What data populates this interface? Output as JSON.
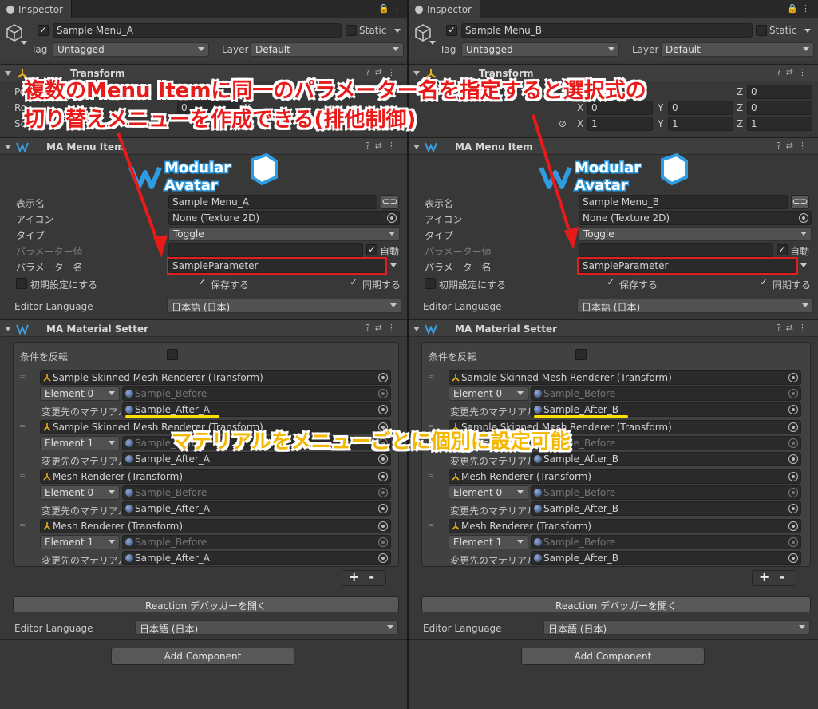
{
  "inspectors": [
    {
      "tab_label": "Inspector",
      "object_name": "Sample Menu_A",
      "static_label": "Static",
      "tag_label": "Tag",
      "tag_value": "Untagged",
      "layer_label": "Layer",
      "layer_value": "Default",
      "transform": {
        "title": "Transform",
        "pos_label": "Po",
        "rot_label": "Ro",
        "scale_label": "Sca",
        "row2_x": "0",
        "row2_mid": "X",
        "row3_mid": "1"
      },
      "menu_item": {
        "title": "MA Menu Item",
        "logo_line1": "Modular",
        "logo_line2": "Avatar",
        "display_name_label": "表示名",
        "display_name_value": "Sample Menu_A",
        "icon_label": "アイコン",
        "icon_value": "None (Texture 2D)",
        "type_label": "タイプ",
        "type_value": "Toggle",
        "param_value_label": "パラメーター値",
        "auto_label": "自動",
        "param_name_label": "パラメーター名",
        "param_name_value": "SampleParameter",
        "default_label": "初期設定にする",
        "saved_label": "保存する",
        "synced_label": "同期する",
        "editor_lang_label": "Editor Language",
        "editor_lang_value": "日本語 (日本)"
      },
      "material_setter": {
        "title": "MA Material Setter",
        "invert_label": "条件を反転",
        "change_label": "変更先のマテリアル",
        "entries": [
          {
            "renderer": "Sample Skinned Mesh Renderer (Transform)",
            "element": "Element 0",
            "before": "Sample_Before",
            "after": "Sample_After_A"
          },
          {
            "renderer": "Sample Skinned Mesh Renderer (Transform)",
            "element": "Element 1",
            "before": "Sample_Before",
            "after": "Sample_After_A"
          },
          {
            "renderer": "Mesh Renderer (Transform)",
            "element": "Element 0",
            "before": "Sample_Before",
            "after": "Sample_After_A"
          },
          {
            "renderer": "Mesh Renderer (Transform)",
            "element": "Element 1",
            "before": "Sample_Before",
            "after": "Sample_After_A"
          }
        ],
        "plus": "+",
        "minus": "-",
        "debugger_button": "Reaction デバッガーを開く",
        "editor_lang_label": "Editor Language",
        "editor_lang_value": "日本語 (日本)"
      },
      "add_component": "Add Component"
    },
    {
      "tab_label": "Inspector",
      "object_name": "Sample Menu_B",
      "static_label": "Static",
      "tag_label": "Tag",
      "tag_value": "Untagged",
      "layer_label": "Layer",
      "layer_value": "Default",
      "transform": {
        "title": "Transform",
        "pos_label": "osit",
        "z_label": "Z",
        "x_label": "X",
        "y_label": "Y",
        "pos_z": "0",
        "rot_x": "0",
        "rot_y": "0",
        "rot_z": "0",
        "scale_x": "1",
        "scale_y": "1",
        "scale_z": "1"
      },
      "menu_item": {
        "title": "MA Menu Item",
        "logo_line1": "Modular",
        "logo_line2": "Avatar",
        "display_name_label": "表示名",
        "display_name_value": "Sample Menu_B",
        "icon_label": "アイコン",
        "icon_value": "None (Texture 2D)",
        "type_label": "タイプ",
        "type_value": "Toggle",
        "param_value_label": "パラメーター値",
        "auto_label": "自動",
        "param_name_label": "パラメーター名",
        "param_name_value": "SampleParameter",
        "default_label": "初期設定にする",
        "saved_label": "保存する",
        "synced_label": "同期する",
        "editor_lang_label": "Editor Language",
        "editor_lang_value": "日本語 (日本)"
      },
      "material_setter": {
        "title": "MA Material Setter",
        "invert_label": "条件を反転",
        "change_label": "変更先のマテリアル",
        "entries": [
          {
            "renderer": "Sample Skinned Mesh Renderer (Transform)",
            "element": "Element 0",
            "before": "Sample_Before",
            "after": "Sample_After_B"
          },
          {
            "renderer": "Sample Skinned Mesh Renderer (Transform)",
            "element": "Element 1",
            "before": "Sample_Before",
            "after": "Sample_After_B"
          },
          {
            "renderer": "Mesh Renderer (Transform)",
            "element": "Element 0",
            "before": "Sample_Before",
            "after": "Sample_After_B"
          },
          {
            "renderer": "Mesh Renderer (Transform)",
            "element": "Element 1",
            "before": "Sample_Before",
            "after": "Sample_After_B"
          }
        ],
        "plus": "+",
        "minus": "-",
        "debugger_button": "Reaction デバッガーを開く",
        "editor_lang_label": "Editor Language",
        "editor_lang_value": "日本語 (日本)"
      },
      "add_component": "Add Component"
    }
  ],
  "annotations": {
    "red_line1": "複数のMenu Itemに同一のパラメーター名を指定すると選択式の",
    "red_line2": "切り替えメニューを作成できる(排他制御)",
    "yellow_text": "マテリアルをメニューごとに個別に設定可能",
    "red_color": "#e81a1a",
    "yellow_color": "#f5b800"
  },
  "colors": {
    "panel_bg": "#383838",
    "field_bg": "#2a2a2a",
    "header_bg": "#3e3e3e"
  }
}
